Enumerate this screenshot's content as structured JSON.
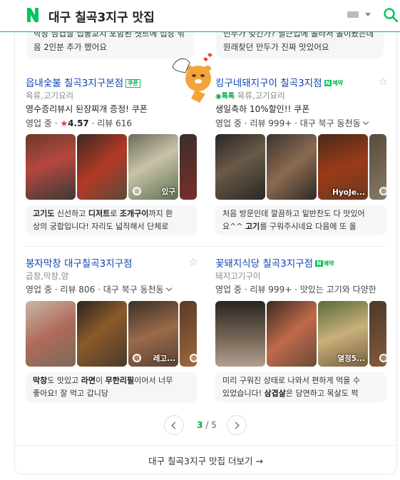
{
  "header": {
    "query": "대구 칠곡3지구 맛집",
    "logo_letter": "N"
  },
  "prev_descriptions": [
    {
      "line1": "막창 삼겹살 섭풍교치 포함된 셋트에 섭장 밖",
      "line2": "음 2인분 추가 했어요"
    },
    {
      "line1": "민두가 엊긴가? 딜근입에 돌라서 돌이봤는데",
      "line2": "원래찾던 만두가 진짜 맛있어요"
    }
  ],
  "restaurants": [
    {
      "name": "읍내숯불 칠곡3지구본점",
      "tag": "쿠폰",
      "category": "육류,고기요리",
      "promo": "영수증리뷰시 된장찌개 증정! 쿠폰",
      "status": "영업 중",
      "rating": "4.57",
      "reviews": "리뷰 616",
      "photo_label": "있구",
      "desc_line1": [
        {
          "t": "고기도",
          "b": true
        },
        {
          "t": " 신선하고 "
        },
        {
          "t": "디저트",
          "b": true
        },
        {
          "t": "로 "
        },
        {
          "t": "조개구이",
          "b": true
        },
        {
          "t": "까지 환"
        }
      ],
      "desc_line2": "상의 궁합입니다! 자리도 넓직해서 단체로"
    },
    {
      "name": "킹구네돼지구이 칠곡3지점",
      "tag": "예약",
      "badge": "톡톡",
      "category": "육류,고기요리",
      "promo": "생일축하 10%할인!! 쿠폰",
      "status": "영업 중",
      "reviews": "리뷰 999+",
      "location": "대구 북구 동천동",
      "photo_label": "HyoJe...",
      "desc_line1": [
        {
          "t": "처음 방문인데 깔끔하고 밑반찬도 다 맛있어"
        }
      ],
      "desc_line2_parts": [
        {
          "t": "요^^ "
        },
        {
          "t": "고기",
          "b": true
        },
        {
          "t": "를 구워주시네요 다음에 또 올"
        }
      ]
    },
    {
      "name": "봉자막창 대구칠곡3지구점",
      "category": "곱창,막창,양",
      "status": "영업 중",
      "reviews": "리뷰 806",
      "location": "대구 북구 동천동",
      "photo_label": "레고...",
      "desc_line1": [
        {
          "t": "막창",
          "b": true
        },
        {
          "t": "도 맛있고 "
        },
        {
          "t": "라면",
          "b": true
        },
        {
          "t": "이 "
        },
        {
          "t": "무한리필",
          "b": true
        },
        {
          "t": "이어서 너무"
        }
      ],
      "desc_line2": "좋아요! 잘 먹고 갑니당"
    },
    {
      "name": "꽃돼지식당 칠곡3지구점",
      "tag": "예약",
      "category": "돼지고기구이",
      "status": "영업 중",
      "reviews": "리뷰 999+",
      "extra": "맛있는 고기와 다양한",
      "photo_label": "열정5...",
      "desc_line1": [
        {
          "t": "미리 구워진 상태로 나와서 편하게 먹을 수"
        }
      ],
      "desc_line2_parts": [
        {
          "t": "있었습니다! "
        },
        {
          "t": "삼겹살",
          "b": true
        },
        {
          "t": "은 당연하고 목살도 퍽"
        }
      ]
    }
  ],
  "pager": {
    "current": "3",
    "separator": "/",
    "total": "5"
  },
  "more_label": "대구 칠곡3지구 맛집 더보기 →",
  "colors": {
    "brand_green": "#03c75a",
    "link_blue": "#0f45b5"
  }
}
